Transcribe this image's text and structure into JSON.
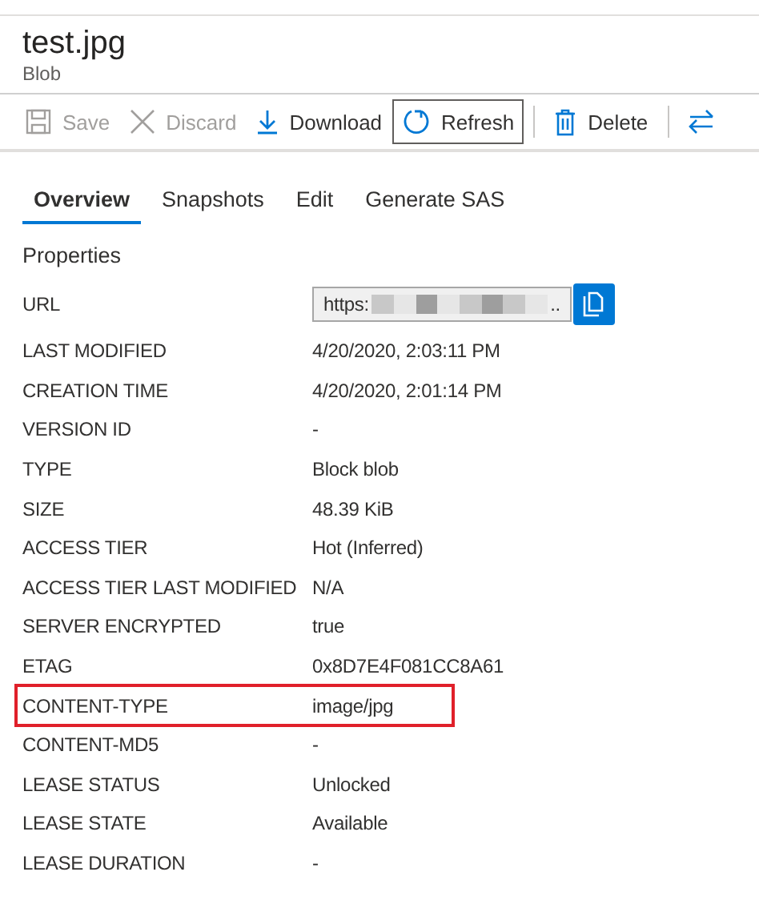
{
  "header": {
    "title": "test.jpg",
    "subtitle": "Blob"
  },
  "toolbar": [
    {
      "kind": "save",
      "label": "Save",
      "disabled": true,
      "focused": false
    },
    {
      "kind": "discard",
      "label": "Discard",
      "disabled": true,
      "focused": false
    },
    {
      "kind": "download",
      "label": "Download",
      "disabled": false,
      "focused": false
    },
    {
      "kind": "refresh",
      "label": "Refresh",
      "disabled": false,
      "focused": true
    },
    {
      "kind": "separator"
    },
    {
      "kind": "delete",
      "label": "Delete",
      "disabled": false,
      "focused": false
    },
    {
      "kind": "separator"
    },
    {
      "kind": "swap",
      "disabled": false,
      "focused": false
    }
  ],
  "tabs": [
    {
      "label": "Overview",
      "selected": true
    },
    {
      "label": "Snapshots",
      "selected": false
    },
    {
      "label": "Edit",
      "selected": false
    },
    {
      "label": "Generate SAS",
      "selected": false
    }
  ],
  "properties": {
    "heading": "Properties",
    "url": {
      "label": "URL",
      "value": "https:",
      "redacted": true,
      "tail": ".."
    },
    "rows": [
      {
        "label": "LAST MODIFIED",
        "value": "4/20/2020, 2:03:11 PM",
        "highlighted": false
      },
      {
        "label": "CREATION TIME",
        "value": "4/20/2020, 2:01:14 PM",
        "highlighted": false
      },
      {
        "label": "VERSION ID",
        "value": "-",
        "highlighted": false
      },
      {
        "label": "TYPE",
        "value": "Block blob",
        "highlighted": false
      },
      {
        "label": "SIZE",
        "value": "48.39 KiB",
        "highlighted": false
      },
      {
        "label": "ACCESS TIER",
        "value": "Hot (Inferred)",
        "highlighted": false
      },
      {
        "label": "ACCESS TIER LAST MODIFIED",
        "value": "N/A",
        "highlighted": false
      },
      {
        "label": "SERVER ENCRYPTED",
        "value": "true",
        "highlighted": false
      },
      {
        "label": "ETAG",
        "value": "0x8D7E4F081CC8A61",
        "highlighted": false
      },
      {
        "label": "CONTENT-TYPE",
        "value": "image/jpg",
        "highlighted": true
      },
      {
        "label": "CONTENT-MD5",
        "value": "-",
        "highlighted": false
      },
      {
        "label": "LEASE STATUS",
        "value": "Unlocked",
        "highlighted": false
      },
      {
        "label": "LEASE STATE",
        "value": "Available",
        "highlighted": false
      },
      {
        "label": "LEASE DURATION",
        "value": "-",
        "highlighted": false
      }
    ]
  }
}
